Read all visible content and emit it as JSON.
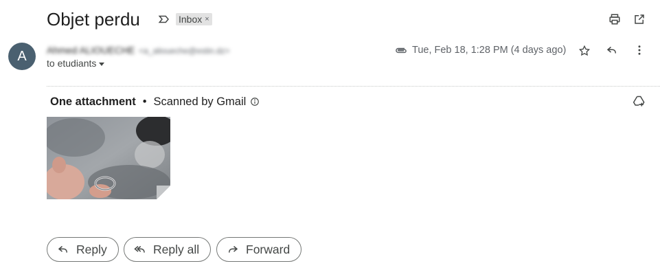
{
  "email": {
    "subject": "Objet perdu",
    "labels": [
      {
        "name": "Inbox",
        "close": "×"
      }
    ],
    "sender_initial": "A",
    "sender_name": "Ahmed ALIOUECHE",
    "sender_email": "<a_alioueche@estin.dz>",
    "recipients": "to etudiants",
    "date": "Tue, Feb 18, 1:28 PM (4 days ago)"
  },
  "attachments": {
    "title": "One attachment",
    "bullet": "•",
    "scanned": "Scanned by Gmail"
  },
  "actions": {
    "reply": "Reply",
    "reply_all": "Reply all",
    "forward": "Forward"
  },
  "icons": {
    "label": "label-outline-icon",
    "print": "print-icon",
    "open_new": "open-in-new-window-icon",
    "attachment": "paperclip-icon",
    "star": "star-outline-icon",
    "reply": "reply-icon",
    "more": "more-vertical-icon",
    "info": "info-icon",
    "drive": "add-to-drive-icon",
    "reply_all": "reply-all-icon",
    "forward": "forward-icon"
  },
  "colors": {
    "avatar": "#4a6070",
    "chip": "#e2e2e2",
    "text_primary": "#1f1f1f",
    "text_secondary": "#5f6368"
  }
}
